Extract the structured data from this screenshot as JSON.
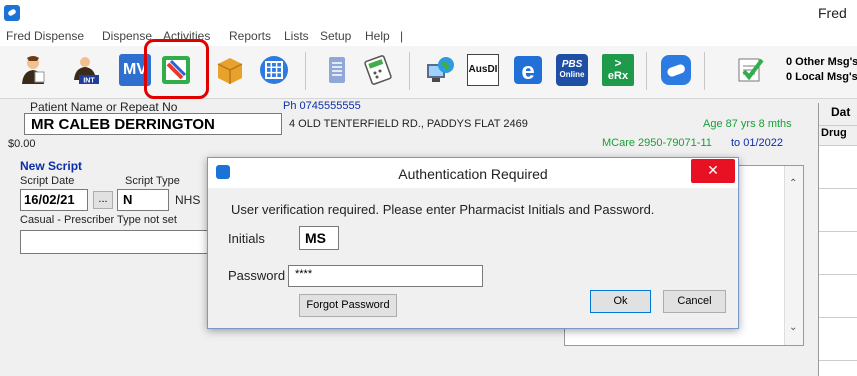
{
  "window": {
    "title": "Fred"
  },
  "menu": [
    {
      "label": "Fred Dispense"
    },
    {
      "label": "Dispense"
    },
    {
      "label": "Activities"
    },
    {
      "label": "Reports"
    },
    {
      "label": "Lists"
    },
    {
      "label": "Setup"
    },
    {
      "label": "Help"
    },
    {
      "label": "|"
    }
  ],
  "toolbar": {
    "int_label": "INT",
    "mv_label": "MV",
    "ausdi_label": "AusDI",
    "pbs_label": "PBS",
    "pbs_sub": "Online",
    "erx_label": "eRx",
    "other_msgs": "0 Other Msg's",
    "local_msgs": "0 Local Msg's"
  },
  "patient": {
    "name_label": "Patient Name or Repeat No",
    "name": "MR CALEB DERRINGTON",
    "phone": "Ph 0745555555",
    "address": "4 OLD TENTERFIELD RD., PADDYS FLAT 2469",
    "age": "Age 87 yrs 8 mths",
    "medicare": "MCare 2950-79071-11",
    "medicare_to": "to 01/2022",
    "balance": "$0.00"
  },
  "right_table": {
    "col1": "Dat",
    "col2": "Drug"
  },
  "script": {
    "header": "New Script",
    "date_label": "Script Date",
    "type_label": "Script Type",
    "date": "16/02/21",
    "browse": "...",
    "type": "N",
    "type_desc": "NHS",
    "prescriber": "Casual - Prescriber Type not set"
  },
  "dialog": {
    "title": "Authentication Required",
    "close": "✕",
    "message": "User verification required. Please enter Pharmacist Initials and Password.",
    "initials_label": "Initials",
    "initials_value": "MS",
    "password_label": "Password",
    "password_value": "****",
    "forgot_label": "Forgot Password",
    "ok_label": "Ok",
    "cancel_label": "Cancel"
  }
}
